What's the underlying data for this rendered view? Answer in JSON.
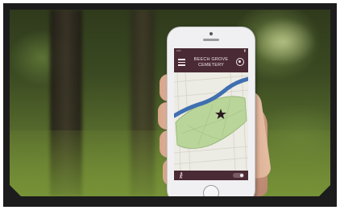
{
  "app": {
    "title_line1": "BEECH GROVE",
    "title_line2": "CEMETERY"
  },
  "statusbar": {
    "carrier": "•••• ",
    "battery": "▮"
  },
  "icons": {
    "menu": "hamburger-menu-icon",
    "compass": "compass-icon",
    "marker": "star-marker-icon",
    "walk": "walking-person-icon",
    "toggle": "toggle-switch-icon"
  },
  "colors": {
    "brand": "#4a2a35",
    "map_river": "#3f6fb0",
    "map_park": "#b9d59a",
    "map_background": "#ecebe4"
  }
}
